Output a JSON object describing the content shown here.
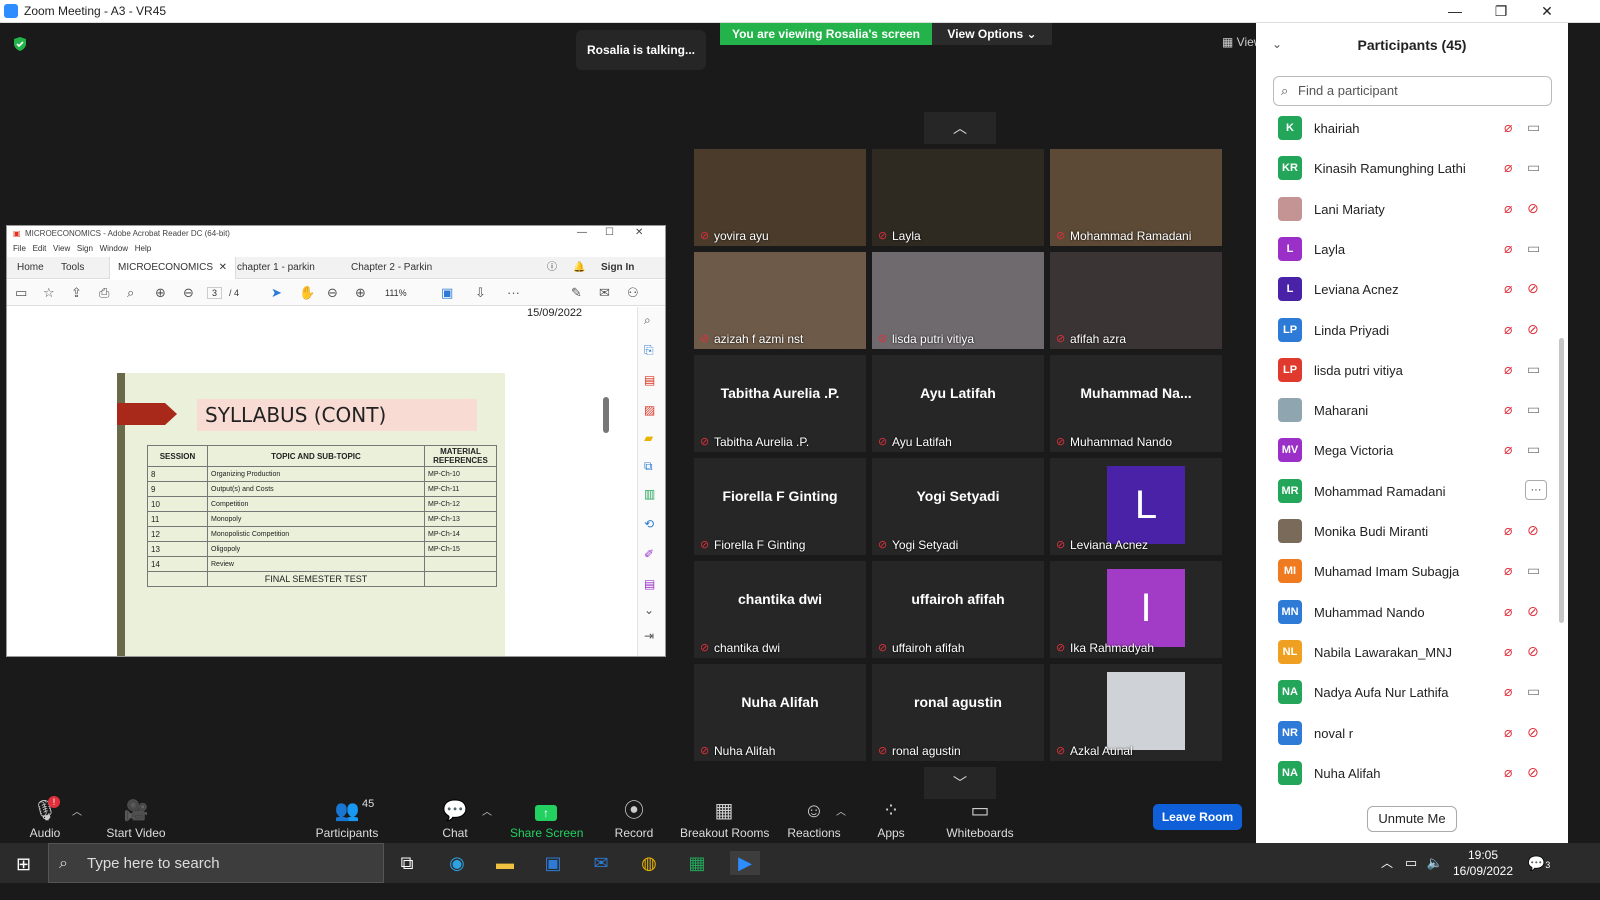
{
  "window": {
    "title": "Zoom Meeting - A3 - VR45",
    "minimize": "—",
    "maximize": "❐",
    "close": "✕"
  },
  "share": {
    "viewing_banner": "You are viewing Rosalia's screen",
    "view_options": "View Options ⌄",
    "talking": "Rosalia is talking...",
    "view_button": "View"
  },
  "pdf": {
    "title": "MICROECONOMICS - Adobe Acrobat Reader DC (64-bit)",
    "menu": [
      "File",
      "Edit",
      "View",
      "Sign",
      "Window",
      "Help"
    ],
    "home_tab": "Home",
    "tools_tab": "Tools",
    "tabs": [
      "MICROECONOMICS",
      "chapter 1 - parkin",
      "Chapter 2 - Parkin"
    ],
    "sign_in": "Sign In",
    "page_current": "3",
    "page_total": "/ 4",
    "zoom": "111%",
    "date": "15/09/2022",
    "slide": {
      "title": "SYLLABUS (CONT)",
      "headers": [
        "SESSION",
        "TOPIC AND SUB-TOPIC",
        "MATERIAL REFERENCES"
      ],
      "rows": [
        {
          "session": "8",
          "topic": "Organizing Production",
          "ref": "MP-Ch-10"
        },
        {
          "session": "9",
          "topic": "Output(s) and Costs",
          "ref": "MP-Ch-11"
        },
        {
          "session": "10",
          "topic": "Competition",
          "ref": "MP-Ch-12"
        },
        {
          "session": "11",
          "topic": "Monopoly",
          "ref": "MP-Ch-13"
        },
        {
          "session": "12",
          "topic": "Monopolistic Competition",
          "ref": "MP-Ch-14"
        },
        {
          "session": "13",
          "topic": "Oligopoly",
          "ref": "MP-Ch-15"
        },
        {
          "session": "14",
          "topic": "Review",
          "ref": ""
        }
      ],
      "final": "FINAL SEMESTER TEST"
    }
  },
  "gallery": {
    "tiles": [
      {
        "name": "yovira ayu",
        "big": "",
        "kind": "video",
        "color": "#4a3b2a"
      },
      {
        "name": "Layla",
        "big": "",
        "kind": "video",
        "color": "#2e2a22"
      },
      {
        "name": "Mohammad Ramadani",
        "big": "",
        "kind": "video",
        "color": "#5c4a36"
      },
      {
        "name": "azizah f azmi nst",
        "big": "",
        "kind": "video",
        "color": "#6e5a48"
      },
      {
        "name": "lisda putri vitiya",
        "big": "",
        "kind": "video",
        "color": "#6f6a6e"
      },
      {
        "name": "afifah azra",
        "big": "",
        "kind": "video",
        "color": "#3a3434"
      },
      {
        "name": "Tabitha Aurelia .P.",
        "big": "Tabitha Aurelia .P.",
        "kind": "name"
      },
      {
        "name": "Ayu Latifah",
        "big": "Ayu Latifah",
        "kind": "name"
      },
      {
        "name": "Muhammad Nando",
        "big": "Muhammad  Na...",
        "kind": "name"
      },
      {
        "name": "Fiorella F Ginting",
        "big": "Fiorella F Ginting",
        "kind": "name"
      },
      {
        "name": "Yogi Setyadi",
        "big": "Yogi Setyadi",
        "kind": "name"
      },
      {
        "name": "Leviana Acnez",
        "big": "L",
        "kind": "avatar",
        "color": "#4a22a8"
      },
      {
        "name": "chantika dwi",
        "big": "chantika dwi",
        "kind": "name"
      },
      {
        "name": "uffairoh afifah",
        "big": "uffairoh afifah",
        "kind": "name"
      },
      {
        "name": "Ika Rahmadyah",
        "big": "I",
        "kind": "avatar",
        "color": "#a23cc6"
      },
      {
        "name": "Nuha Alifah",
        "big": "Nuha Alifah",
        "kind": "name"
      },
      {
        "name": "ronal agustin",
        "big": "ronal agustin",
        "kind": "name"
      },
      {
        "name": "Azkal Aunal",
        "big": "",
        "kind": "photo",
        "color": "#cfd2d6"
      }
    ]
  },
  "participants": {
    "title": "Participants (45)",
    "search_placeholder": "Find a participant",
    "unmute_me": "Unmute Me",
    "list": [
      {
        "initials": "K",
        "name": "khairiah",
        "color": "#23a55a",
        "cam_off": false
      },
      {
        "initials": "KR",
        "name": "Kinasih Ramunghing Lathi",
        "color": "#23a55a",
        "cam_off": false
      },
      {
        "initials": "",
        "name": "Lani Mariaty",
        "color": "#c49494",
        "cam_off": true
      },
      {
        "initials": "L",
        "name": "Layla",
        "color": "#9b30c8",
        "cam_off": false
      },
      {
        "initials": "L",
        "name": "Leviana Acnez",
        "color": "#4a22a8",
        "cam_off": true
      },
      {
        "initials": "LP",
        "name": "Linda Priyadi",
        "color": "#2d7bd6",
        "cam_off": true
      },
      {
        "initials": "LP",
        "name": "lisda putri vitiya",
        "color": "#e03a2e",
        "cam_off": false
      },
      {
        "initials": "",
        "name": "Maharani",
        "color": "#8fa6b0",
        "cam_off": false
      },
      {
        "initials": "MV",
        "name": "Mega Victoria",
        "color": "#9b30c8",
        "cam_off": false
      },
      {
        "initials": "MR",
        "name": "Mohammad Ramadani",
        "color": "#23a55a",
        "more": "···"
      },
      {
        "initials": "",
        "name": "Monika Budi Miranti",
        "color": "#7a6a5a",
        "cam_off": true
      },
      {
        "initials": "MI",
        "name": "Muhamad Imam Subagja",
        "color": "#f07a20",
        "cam_off": false
      },
      {
        "initials": "MN",
        "name": "Muhammad Nando",
        "color": "#2d7bd6",
        "cam_off": true
      },
      {
        "initials": "NL",
        "name": "Nabila Lawarakan_MNJ",
        "color": "#f0a020",
        "cam_off": true
      },
      {
        "initials": "NA",
        "name": "Nadya Aufa Nur Lathifa",
        "color": "#23a55a",
        "cam_off": false
      },
      {
        "initials": "NR",
        "name": "noval r",
        "color": "#2d7bd6",
        "cam_off": true
      },
      {
        "initials": "NA",
        "name": "Nuha Alifah",
        "color": "#23a55a",
        "cam_off": true
      }
    ]
  },
  "toolbar": {
    "audio": "Audio",
    "audio_badge": "!",
    "start_video": "Start Video",
    "participants": "Participants",
    "participants_count": "45",
    "chat": "Chat",
    "share_screen": "Share Screen",
    "record": "Record",
    "breakout_rooms": "Breakout Rooms",
    "reactions": "Reactions",
    "apps": "Apps",
    "whiteboards": "Whiteboards",
    "leave": "Leave Room"
  },
  "taskbar": {
    "search_placeholder": "Type here to search",
    "time": "19:05",
    "date": "16/09/2022",
    "notifications": "3"
  }
}
